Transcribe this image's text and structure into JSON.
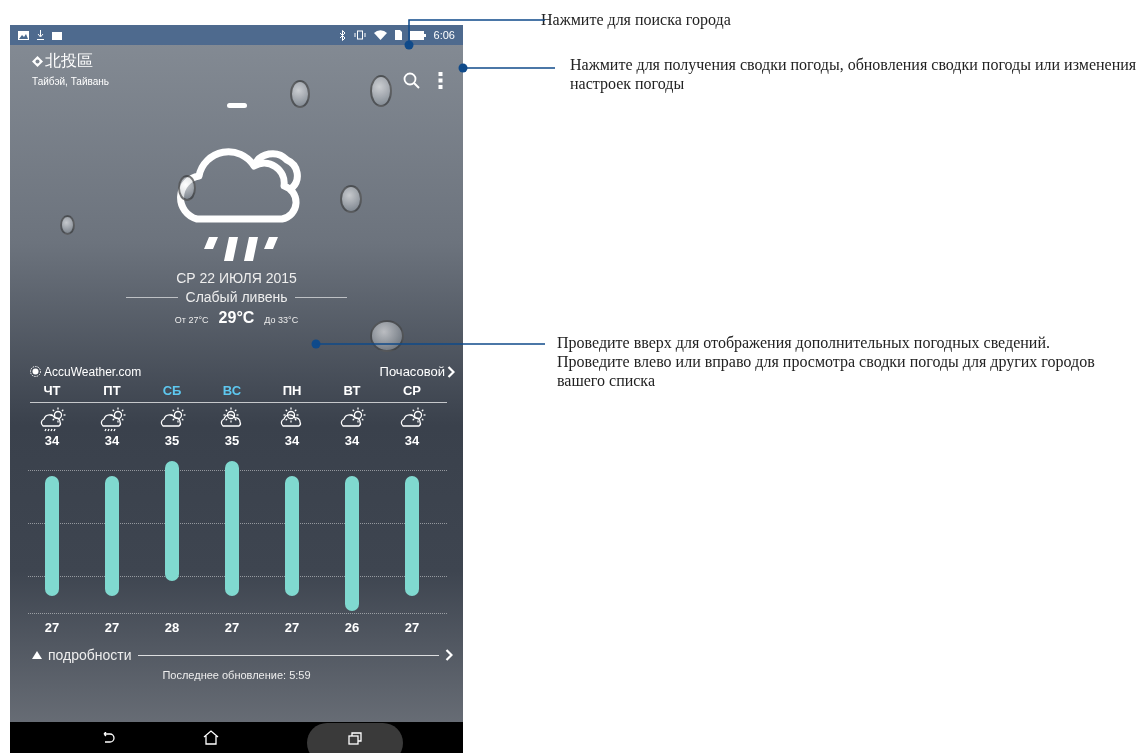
{
  "status_bar": {
    "time": "6:06"
  },
  "location": {
    "name": "北投區",
    "region": "Тайбэй, Тайвань"
  },
  "weather": {
    "date": "СР 22 ИЮЛЯ 2015",
    "condition": "Слабый ливень",
    "low": "От 27°C",
    "current": "29°C",
    "high": "До 33°C"
  },
  "provider": "AccuWeather.com",
  "hourly_link": "Почасовой",
  "forecast": [
    {
      "day": "ЧТ",
      "weekend": false,
      "kind": "rain",
      "high": "34",
      "low": "27"
    },
    {
      "day": "ПТ",
      "weekend": false,
      "kind": "rain",
      "high": "34",
      "low": "27"
    },
    {
      "day": "СБ",
      "weekend": true,
      "kind": "cloud-sun",
      "high": "35",
      "low": "28"
    },
    {
      "day": "ВС",
      "weekend": true,
      "kind": "sun-cloud",
      "high": "35",
      "low": "27"
    },
    {
      "day": "ПН",
      "weekend": false,
      "kind": "sun-cloud",
      "high": "34",
      "low": "27"
    },
    {
      "day": "ВТ",
      "weekend": false,
      "kind": "cloud-sun",
      "high": "34",
      "low": "26"
    },
    {
      "day": "СР",
      "weekend": false,
      "kind": "cloud-sun",
      "high": "34",
      "low": "27"
    }
  ],
  "details_label": "подробности",
  "last_update": "Последнее обновление: 5:59",
  "callouts": [
    {
      "lines": [
        "Нажмите для поиска города"
      ]
    },
    {
      "lines": [
        "Нажмите для получения сводки погоды, обновления сводки погоды или изменения настроек погоды"
      ]
    },
    {
      "lines": [
        "Проведите вверх для отображения дополнительных погодных сведений.",
        "Проведите влево или вправо для просмотра сводки погоды для других городов вашего списка"
      ]
    }
  ]
}
